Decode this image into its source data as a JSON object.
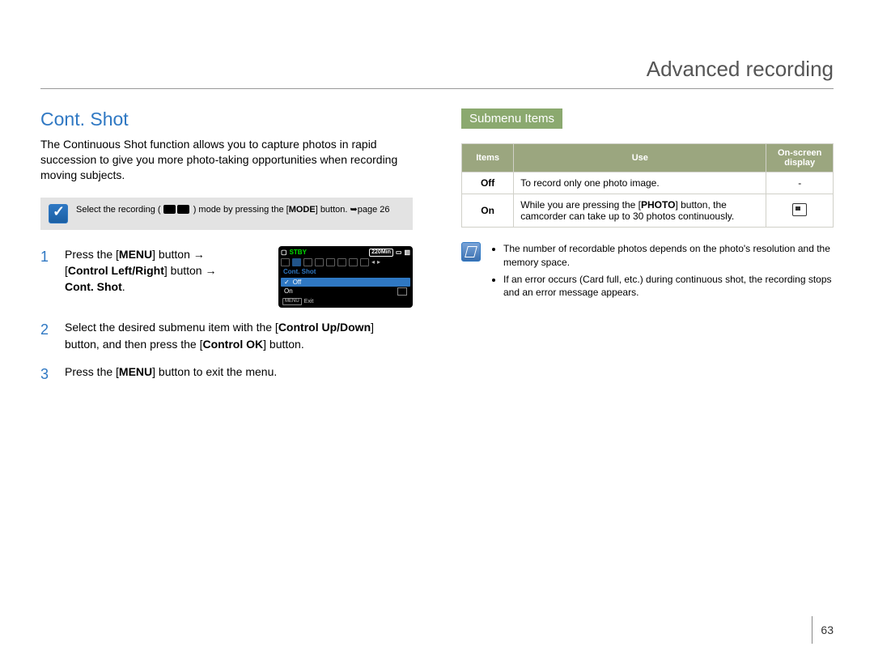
{
  "page_title": "Advanced recording",
  "page_number": "63",
  "left": {
    "section_title": "Cont. Shot",
    "intro": "The Continuous Shot function allows you to capture photos in rapid succession to give you more photo-taking opportunities when recording moving subjects.",
    "tip_prefix": "Select the recording (",
    "tip_mid": ") mode by pressing the [",
    "tip_mode": "MODE",
    "tip_suffix": "] button. ",
    "tip_pageref": "page 26",
    "step1_a": "Press the [",
    "step1_menu": "MENU",
    "step1_b": "] button ",
    "step1_c": "[",
    "step1_ctrl": "Control Left/Right",
    "step1_d": "] button ",
    "step1_e": "Cont. Shot",
    "step1_f": ".",
    "shot_stby": "STBY",
    "shot_time": "220Min",
    "shot_menu_title": "Cont. Shot",
    "shot_off": "Off",
    "shot_on": "On",
    "shot_exit_btn": "MENU",
    "shot_exit": "Exit",
    "step2_a": "Select the desired submenu item with the [",
    "step2_b": "Control Up/Down",
    "step2_c": "] button, and then press the [",
    "step2_d": "Control OK",
    "step2_e": "] button.",
    "step3_a": "Press the [",
    "step3_b": "MENU",
    "step3_c": "] button to exit the menu."
  },
  "right": {
    "subheader": "Submenu Items",
    "th_items": "Items",
    "th_use": "Use",
    "th_osd1": "On-screen",
    "th_osd2": "display",
    "row_off_item": "Off",
    "row_off_use": "To record only one photo image.",
    "row_off_osd": "-",
    "row_on_item": "On",
    "row_on_use_a": "While you are pressing the [",
    "row_on_use_b": "PHOTO",
    "row_on_use_c": "] button, the camcorder can take up to 30 photos continuously.",
    "note1": "The number of recordable photos depends on the photo's resolution and the memory space.",
    "note2": "If an error occurs (Card full, etc.) during continuous shot, the recording stops and an error message appears."
  }
}
